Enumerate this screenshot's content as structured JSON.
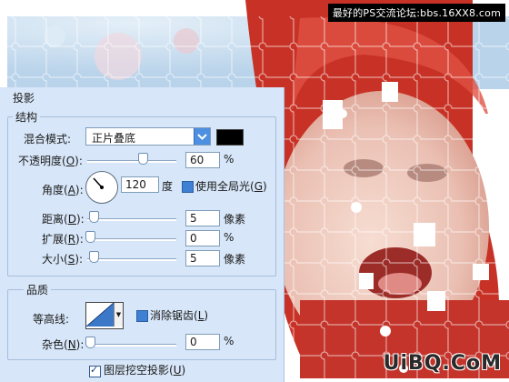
{
  "watermark": "最好的PS交流论坛:bbs.16XX8.com",
  "brand": "UiBQ.CoM",
  "dialog": {
    "section_title": "投影",
    "structure": {
      "legend": "结构",
      "blend_mode_label": "混合模式:",
      "blend_mode_value": "正片叠底",
      "opacity_label": "不透明度(",
      "opacity_key": "O",
      "opacity_value": "60",
      "opacity_unit": "%",
      "angle_label": "角度(",
      "angle_key": "A",
      "angle_value": "120",
      "angle_unit": "度",
      "global_light_label": "使用全局光(",
      "global_light_key": "G",
      "distance_label": "距离(",
      "distance_key": "D",
      "distance_value": "5",
      "distance_unit": "像素",
      "spread_label": "扩展(",
      "spread_key": "R",
      "spread_value": "0",
      "spread_unit": "%",
      "size_label": "大小(",
      "size_key": "S",
      "size_value": "5",
      "size_unit": "像素"
    },
    "quality": {
      "legend": "品质",
      "contour_label": "等高线:",
      "antialias_label": "消除锯齿(",
      "antialias_key": "L",
      "noise_label": "杂色(",
      "noise_key": "N",
      "noise_value": "0",
      "noise_unit": "%"
    },
    "knockout_label": "图层挖空投影(",
    "knockout_key": "U"
  }
}
